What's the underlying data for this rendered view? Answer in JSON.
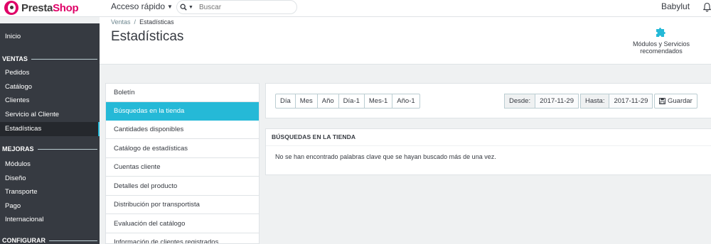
{
  "brand": {
    "name_part1": "Presta",
    "name_part2": "Shop"
  },
  "header": {
    "quick_access": "Acceso rápido",
    "search_placeholder": "Buscar",
    "user": "Babylut"
  },
  "sidebar": {
    "inicio": "Inicio",
    "sections": [
      {
        "title": "VENTAS",
        "items": [
          "Pedidos",
          "Catálogo",
          "Clientes",
          "Servicio al Cliente",
          "Estadísticas"
        ]
      },
      {
        "title": "MEJORAS",
        "items": [
          "Módulos",
          "Diseño",
          "Transporte",
          "Pago",
          "Internacional"
        ]
      },
      {
        "title": "CONFIGURAR",
        "items": []
      }
    ],
    "active_item": "Estadísticas"
  },
  "toolbar": {
    "breadcrumb": [
      "Ventas",
      "Estadísticas"
    ],
    "title": "Estadísticas",
    "modules_link": "Módulos y Servicios recomendados"
  },
  "stats_list": {
    "items": [
      "Boletín",
      "Búsquedas en la tienda",
      "Cantidades disponibles",
      "Catálogo de estadísticas",
      "Cuentas cliente",
      "Detalles del producto",
      "Distribución por transportista",
      "Evaluación del catálogo",
      "Información de clientes registrados"
    ],
    "active_index": 1
  },
  "date_panel": {
    "periods": [
      "Día",
      "Mes",
      "Año",
      "Día-1",
      "Mes-1",
      "Año-1"
    ],
    "from_label": "Desde:",
    "from_value": "2017-11-29",
    "to_label": "Hasta:",
    "to_value": "2017-11-29",
    "save_label": "Guardar"
  },
  "result_panel": {
    "heading": "BÚSQUEDAS EN LA TIENDA",
    "message": "No se han encontrado palabras clave que se hayan buscado más de una vez."
  },
  "colors": {
    "accent": "#25b9d7",
    "brand": "#df0067",
    "sidebar_bg": "#363a41"
  }
}
